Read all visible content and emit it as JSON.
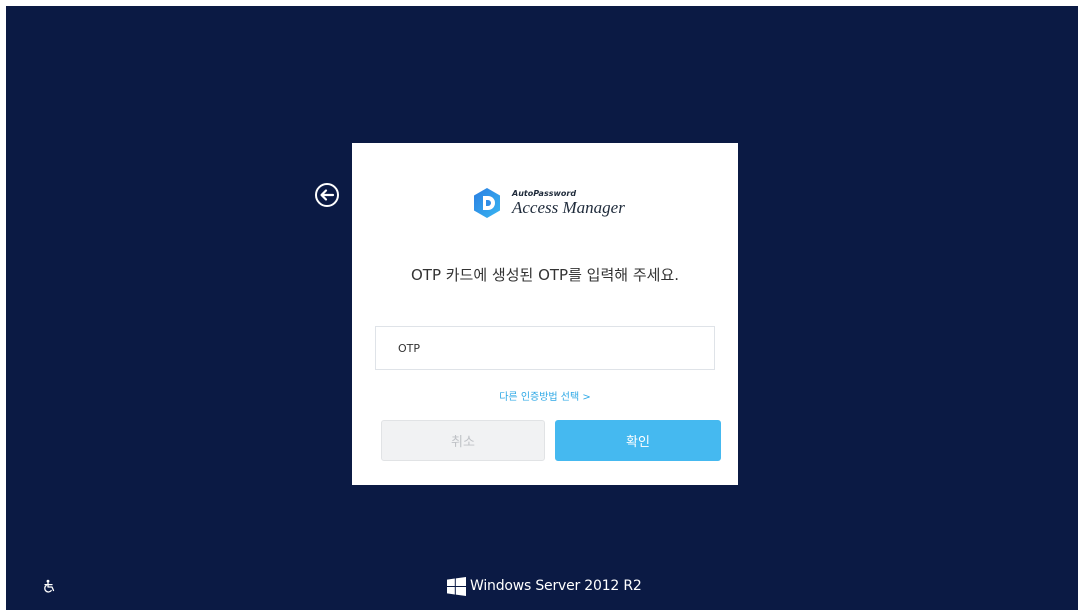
{
  "logo": {
    "brand": "AutoPassword",
    "product": "Access Manager"
  },
  "prompt": "OTP 카드에 생성된 OTP를 입력해 주세요.",
  "otp_field": {
    "placeholder": "OTP",
    "value": ""
  },
  "alt_method_link": "다른 인증방법 선택 >",
  "buttons": {
    "cancel": "취소",
    "confirm": "확인"
  },
  "footer": {
    "os_name": "Windows Server 2012 R2"
  },
  "icons": {
    "back": "arrow-left-circle-icon",
    "ease_of_access": "ease-of-access-icon",
    "windows": "windows-logo-icon"
  },
  "colors": {
    "background": "#0b1a44",
    "accent": "#45b9f0",
    "link": "#2ea8e6"
  }
}
